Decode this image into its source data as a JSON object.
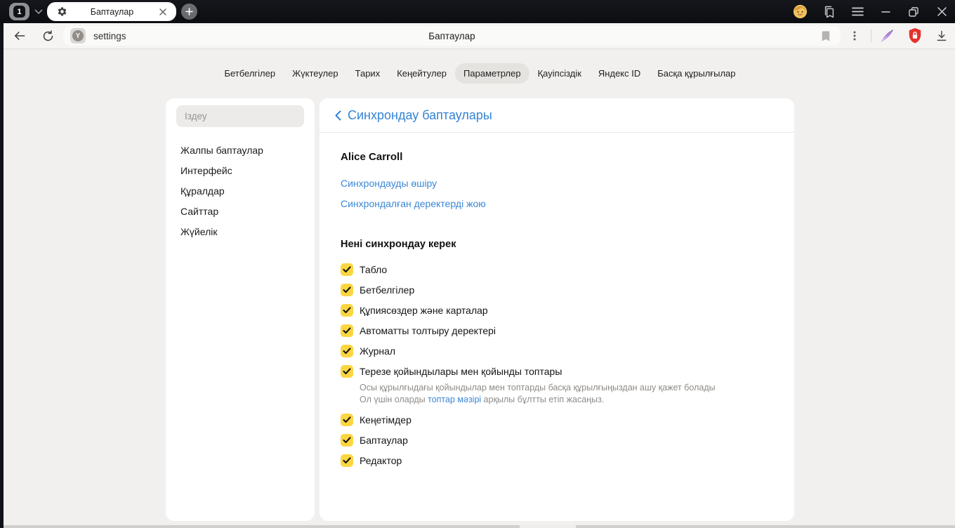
{
  "colors": {
    "accent_blue": "#3583d6",
    "link_blue": "#3a87d6",
    "checkbox_yellow": "#fbd640",
    "protect_red": "#e3342e",
    "feather_purple": "#9a63d2",
    "tabbar_bg": "#0e1014",
    "page_bg": "#f1f0ee"
  },
  "titlebar": {
    "tab_counter": "1",
    "tab_title": "Баптаулар",
    "new_tab_glyph": "+",
    "icons": [
      "tab-counter",
      "chevron-down-icon",
      "gear-icon",
      "close-icon",
      "plus-icon",
      "avatar",
      "collections-icon",
      "menu-icon",
      "minimize-icon",
      "restore-icon",
      "window-close-icon"
    ]
  },
  "toolbar": {
    "address": "settings",
    "page_title": "Баптаулар",
    "favicon_glyph": "Y",
    "icons": [
      "back-icon",
      "reload-icon",
      "site-icon",
      "bookmark-icon",
      "kebab-menu-icon",
      "feather-icon",
      "protect-shield-icon",
      "download-icon"
    ]
  },
  "nav": {
    "tabs": [
      {
        "label": "Бетбелгілер",
        "active": false
      },
      {
        "label": "Жүктеулер",
        "active": false
      },
      {
        "label": "Тарих",
        "active": false
      },
      {
        "label": "Кеңейтулер",
        "active": false
      },
      {
        "label": "Параметрлер",
        "active": true
      },
      {
        "label": "Қауіпсіздік",
        "active": false
      },
      {
        "label": "Яндекс ID",
        "active": false
      },
      {
        "label": "Басқа құрылғылар",
        "active": false
      }
    ]
  },
  "sidebar": {
    "search_placeholder": "Іздеу",
    "items": [
      "Жалпы баптаулар",
      "Интерфейс",
      "Құралдар",
      "Сайттар",
      "Жүйелік"
    ]
  },
  "main": {
    "header": "Синхрондау баптаулары",
    "account_name": "Alice Carroll",
    "link_disable_sync": "Синхрондауды өшіру",
    "link_delete_synced": "Синхрондалған деректерді жою",
    "section_title": "Нені синхрондау керек",
    "checklist": [
      {
        "label": "Табло",
        "checked": true
      },
      {
        "label": "Бетбелгілер",
        "checked": true
      },
      {
        "label": "Құпиясөздер және карталар",
        "checked": true
      },
      {
        "label": "Автоматты толтыру деректері",
        "checked": true
      },
      {
        "label": "Журнал",
        "checked": true
      },
      {
        "label": "Терезе қойындылары мен қойынды топтары",
        "checked": true
      },
      {
        "label": "Кеңетімдер",
        "checked": true
      },
      {
        "label": "Баптаулар",
        "checked": true
      },
      {
        "label": "Редактор",
        "checked": true
      }
    ],
    "tabs_note": {
      "line1": "Осы құрылғыдағы қойындылар мен топтарды басқа құрылғыңыздан ашу қажет болады",
      "line2_pre": "Ол үшін оларды ",
      "line2_link": "топтар мәзірі",
      "line2_post": " арқылы бұлтты етіп жасаңыз."
    }
  }
}
